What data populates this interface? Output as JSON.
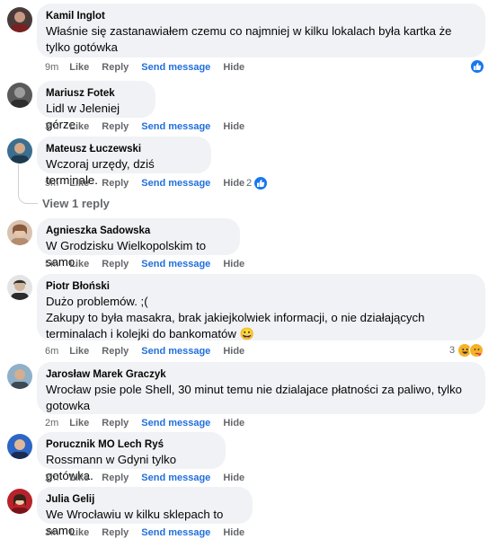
{
  "actions": {
    "like": "Like",
    "reply": "Reply",
    "send": "Send message",
    "hide": "Hide"
  },
  "comments": [
    {
      "author": "Kamil Inglot",
      "text": "Właśnie się zastanawiałem czemu co najmniej w kilku lokalach była kartka że tylko gotówka",
      "time": "9m",
      "reactions": ""
    },
    {
      "author": "Mariusz Fotek",
      "text": "Lidl w Jeleniej górze",
      "time": "3m",
      "reactions": ""
    },
    {
      "author": "Mateusz Łuczewski",
      "text": "Wczoraj urzędy, dziś terminale.",
      "time": "5m",
      "reactions": "2"
    },
    {
      "author": "Agnieszka Sadowska",
      "text": "W Grodzisku Wielkopolskim to samo.",
      "time": "5m",
      "reactions": ""
    },
    {
      "author": "Piotr Błoński",
      "text": "Dużo problemów. ;(\nZakupy to była masakra, brak jakiejkolwiek informacji, o nie działających terminalach i kolejki do bankomatów 😀",
      "time": "6m",
      "reactions": "3"
    },
    {
      "author": "Jarosław Marek Graczyk",
      "text": "Wrocław psie pole Shell, 30 minut temu nie dzialajace płatności za paliwo, tylko gotowka",
      "time": "2m",
      "reactions": ""
    },
    {
      "author": "Porucznik MO Lech Ryś",
      "text": "Rossmann w Gdyni tylko gotówka.",
      "time": "2m",
      "reactions": ""
    },
    {
      "author": "Julia Gelij",
      "text": "We Wrocławiu w kilku sklepach to samo",
      "time": "3m",
      "reactions": ""
    }
  ],
  "view_replies": "View 1 reply",
  "colors": {
    "bubble": "#f0f2f5",
    "link": "#216fdb",
    "meta": "#65676b",
    "like": "#1877f2"
  }
}
